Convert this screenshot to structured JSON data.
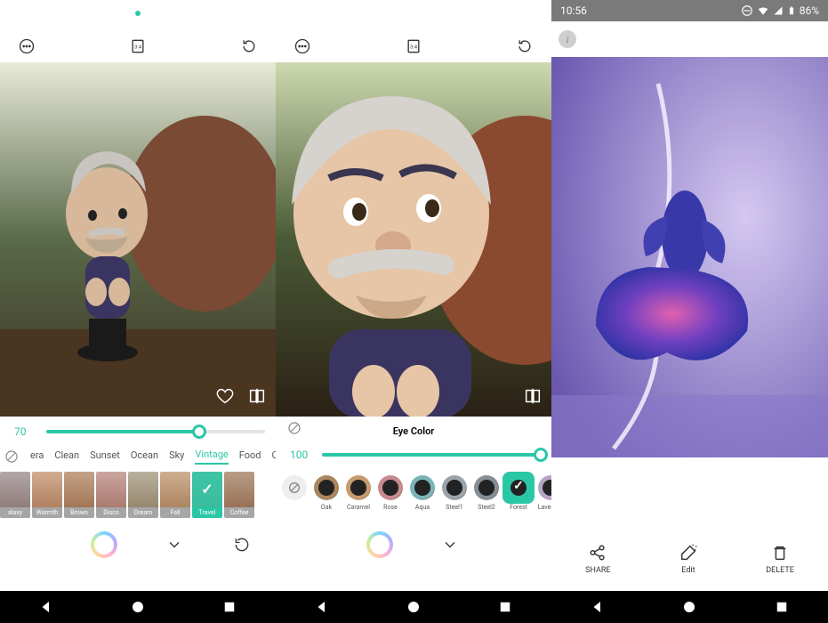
{
  "pane1": {
    "slider_value": "70",
    "slider_percent": 70,
    "categories": [
      "era",
      "Clean",
      "Sunset",
      "Ocean",
      "Sky",
      "Vintage",
      "Food",
      "Color"
    ],
    "active_category": "Vintage",
    "filters": [
      {
        "name": "alaxy",
        "selected": false,
        "tint": "#7a8fb8"
      },
      {
        "name": "Warmth",
        "selected": false,
        "tint": "#c99a7a"
      },
      {
        "name": "Brown",
        "selected": false,
        "tint": "#a58060"
      },
      {
        "name": "Disco",
        "selected": false,
        "tint": "#b88aa0"
      },
      {
        "name": "Dream",
        "selected": false,
        "tint": "#8aa89a"
      },
      {
        "name": "Fall",
        "selected": false,
        "tint": "#bfa27a"
      },
      {
        "name": "Travel",
        "selected": true,
        "tint": "#2ac7a7"
      },
      {
        "name": "Coffee",
        "selected": false,
        "tint": "#8a7460"
      }
    ]
  },
  "pane2": {
    "section_title": "Eye Color",
    "slider_value": "100",
    "slider_percent": 100,
    "lenses": [
      {
        "name": "Oak",
        "color": "#a98660",
        "selected": false
      },
      {
        "name": "Caramel",
        "color": "#c79a70",
        "selected": false
      },
      {
        "name": "Rose",
        "color": "#c78a90",
        "selected": false
      },
      {
        "name": "Aqua",
        "color": "#7ab4b8",
        "selected": false
      },
      {
        "name": "Steel1",
        "color": "#9aa4ac",
        "selected": false
      },
      {
        "name": "Steel2",
        "color": "#848e96",
        "selected": false
      },
      {
        "name": "Forest",
        "color": "#2ac7a7",
        "selected": true
      },
      {
        "name": "Lavender",
        "color": "#b8a4c8",
        "selected": false
      }
    ]
  },
  "pane3": {
    "status_time": "10:56",
    "status_battery": "86%",
    "actions": {
      "share": "SHARE",
      "edit": "Edit",
      "delete": "DELETE"
    }
  }
}
